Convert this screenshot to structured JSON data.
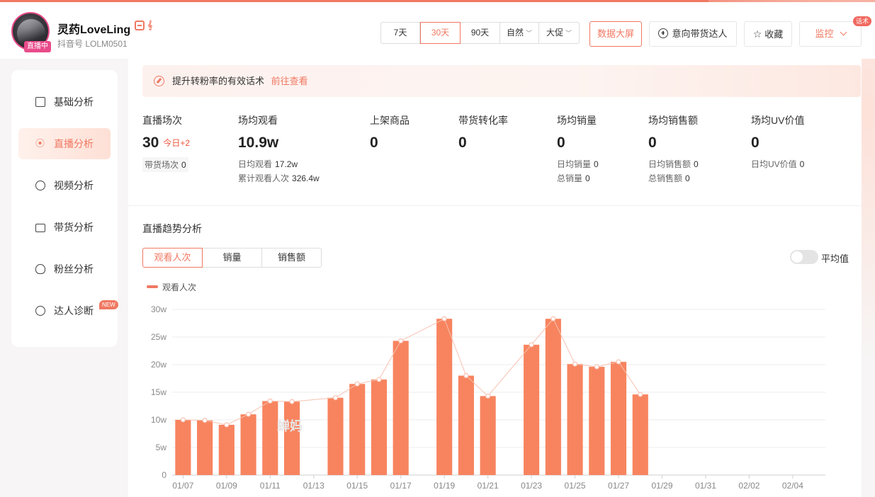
{
  "profile": {
    "name": "灵药LoveLing",
    "account": "抖音号 LOLM0501",
    "live_badge": "直播中",
    "platform_icon": "douyin-icon",
    "douyin_glyph": "𝕕"
  },
  "header": {
    "periods": [
      "7天",
      "30天",
      "90天"
    ],
    "active_period": "30天",
    "dropdown_natural": "自然",
    "dropdown_promo": "大促",
    "big_screen": "数据大屏",
    "intent_talent": "意向带货达人",
    "favorite": "收藏",
    "monitor": "监控",
    "monitor_tag": "话术",
    "star_glyph": "☆"
  },
  "sidebar": {
    "items": [
      {
        "label": "基础分析",
        "icon": "bar-chart-icon"
      },
      {
        "label": "直播分析",
        "icon": "live-icon",
        "active": true
      },
      {
        "label": "视频分析",
        "icon": "play-icon"
      },
      {
        "label": "带货分析",
        "icon": "bag-icon"
      },
      {
        "label": "粉丝分析",
        "icon": "fans-icon"
      },
      {
        "label": "达人诊断",
        "icon": "diagnose-icon",
        "tag": "NEW"
      }
    ],
    "live_glyph": "⦿"
  },
  "tip": {
    "text": "提升转粉率的有效话术",
    "link": "前往查看"
  },
  "stats": {
    "sessions": {
      "label": "直播场次",
      "value": "30",
      "delta": "今日+2",
      "sub_label": "带货场次",
      "sub_value": "0"
    },
    "avg_view": {
      "label": "场均观看",
      "value": "10.9w",
      "sub1_label": "日均观看",
      "sub1_value": "17.2w",
      "sub2_label": "累计观看人次",
      "sub2_value": "326.4w"
    },
    "products": {
      "label": "上架商品",
      "value": "0"
    },
    "conversion": {
      "label": "带货转化率",
      "value": "0"
    },
    "avg_sales": {
      "label": "场均销量",
      "value": "0",
      "sub1_label": "日均销量",
      "sub1_value": "0",
      "sub2_label": "总销量",
      "sub2_value": "0"
    },
    "avg_revenue": {
      "label": "场均销售额",
      "value": "0",
      "sub1_label": "日均销售额",
      "sub1_value": "0",
      "sub2_label": "总销售额",
      "sub2_value": "0"
    },
    "uv": {
      "label": "场均UV价值",
      "value": "0",
      "sub1_label": "日均UV价值",
      "sub1_value": "0"
    }
  },
  "trend": {
    "title": "直播趋势分析",
    "tabs": [
      "观看人次",
      "销量",
      "销售额"
    ],
    "active_tab": "观看人次",
    "toggle_label": "平均值",
    "legend": "观看人次",
    "watermark": "蝉妈"
  },
  "chart_data": {
    "type": "bar",
    "title": "",
    "xlabel": "",
    "ylabel": "",
    "ylim": [
      0,
      30
    ],
    "yticks": [
      "0",
      "5w",
      "10w",
      "15w",
      "20w",
      "25w",
      "30w"
    ],
    "xticks": [
      "01/07",
      "01/09",
      "01/11",
      "01/13",
      "01/15",
      "01/17",
      "01/19",
      "01/21",
      "01/23",
      "01/25",
      "01/27",
      "01/29",
      "01/31",
      "02/02",
      "02/04"
    ],
    "categories": [
      "01/07",
      "01/08",
      "01/09",
      "01/10",
      "01/11",
      "01/12",
      "01/13",
      "01/14",
      "01/15",
      "01/16",
      "01/17",
      "01/18",
      "01/19",
      "01/20",
      "01/21",
      "01/22",
      "01/23",
      "01/24",
      "01/25",
      "01/26",
      "01/27",
      "01/28",
      "01/29",
      "01/30",
      "01/31",
      "02/01",
      "02/02",
      "02/03",
      "02/04",
      "02/05"
    ],
    "series": [
      {
        "name": "观看人次",
        "values": [
          10,
          9.9,
          9.1,
          11,
          13.4,
          13.3,
          null,
          14,
          16.5,
          17.3,
          24.3,
          null,
          28.3,
          18,
          14.3,
          null,
          23.6,
          28.3,
          20.1,
          19.6,
          20.5,
          14.6,
          null,
          null,
          null,
          null,
          null,
          null,
          null,
          null
        ],
        "color": "#f7845f"
      }
    ],
    "line_color": "#f8c1b0",
    "grid": true
  }
}
